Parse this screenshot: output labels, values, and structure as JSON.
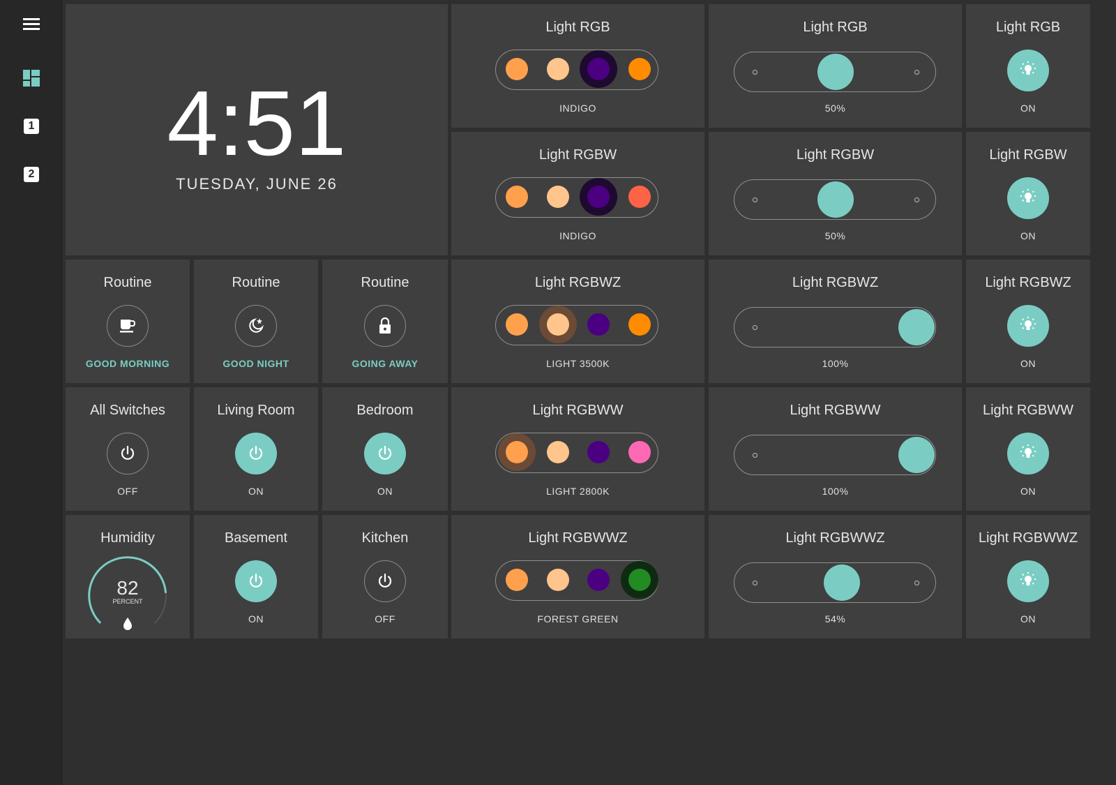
{
  "sidebar": {
    "menu_icon": "menu-icon",
    "items": [
      {
        "icon": "dashboard-icon"
      },
      {
        "label": "1"
      },
      {
        "label": "2"
      }
    ]
  },
  "clock": {
    "time": "4:51",
    "date": "TUESDAY, JUNE 26"
  },
  "colors": {
    "accent": "#7bcdc4",
    "tile_bg": "#3f3f3f",
    "page_bg": "#2f2f2f",
    "orange": "#ffa04d",
    "peach": "#ffc58c",
    "indigo": "#4b0082",
    "dark_orange": "#ff8c00",
    "tomato": "#ff6347",
    "hot_pink": "#ff69b4",
    "forest_green": "#228b22"
  },
  "light_rows": [
    {
      "title": "Light RGB",
      "color_name": "INDIGO",
      "level": "50%",
      "state": "ON"
    },
    {
      "title": "Light RGBW",
      "color_name": "INDIGO",
      "level": "50%",
      "state": "ON"
    },
    {
      "title": "Light RGBWZ",
      "color_name": "LIGHT 3500K",
      "level": "100%",
      "state": "ON"
    },
    {
      "title": "Light RGBWW",
      "color_name": "LIGHT 2800K",
      "level": "100%",
      "state": "ON"
    },
    {
      "title": "Light RGBWWZ",
      "color_name": "FOREST GREEN",
      "level": "54%",
      "state": "ON"
    }
  ],
  "routines": [
    {
      "title": "Routine",
      "name": "GOOD MORNING",
      "icon": "coffee-icon"
    },
    {
      "title": "Routine",
      "name": "GOOD NIGHT",
      "icon": "moon-stars-icon"
    },
    {
      "title": "Routine",
      "name": "GOING AWAY",
      "icon": "lock-icon"
    }
  ],
  "switches": [
    {
      "title": "All Switches",
      "state": "OFF"
    },
    {
      "title": "Living Room",
      "state": "ON"
    },
    {
      "title": "Bedroom",
      "state": "ON"
    },
    {
      "title": "Basement",
      "state": "ON"
    },
    {
      "title": "Kitchen",
      "state": "OFF"
    }
  ],
  "humidity": {
    "title": "Humidity",
    "value": "82",
    "unit": "PERCENT",
    "icon": "water-drop-icon"
  }
}
